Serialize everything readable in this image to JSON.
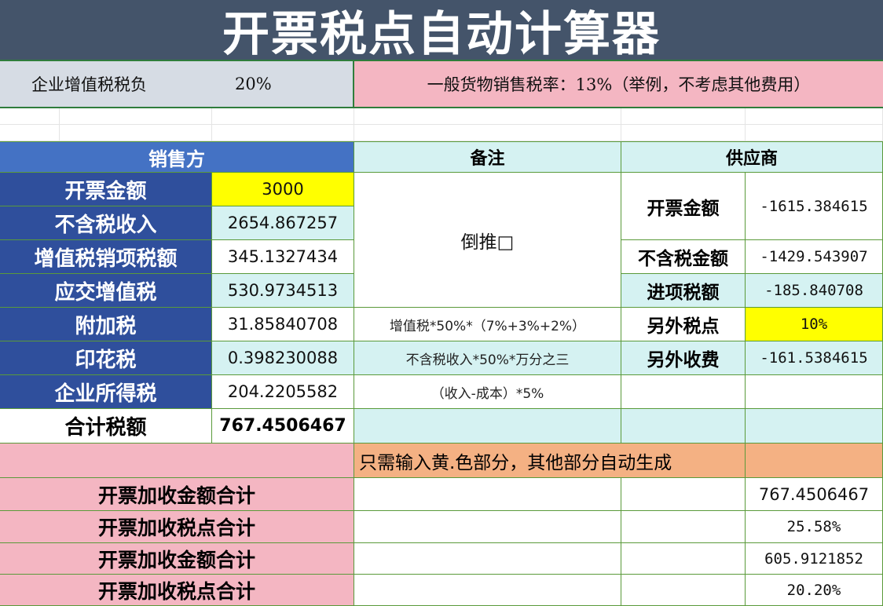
{
  "title": "开票税点自动计算器",
  "info": {
    "label": "企业增值税税负",
    "rate": "20%",
    "note": "一般货物销售税率：13%（举例，不考虑其他费用）"
  },
  "seller": {
    "header": "销售方",
    "rows": [
      {
        "label": "开票金额",
        "value": "3000"
      },
      {
        "label": "不含税收入",
        "value": "2654.867257"
      },
      {
        "label": "增值税销项税额",
        "value": "345.1327434"
      },
      {
        "label": "应交增值税",
        "value": "530.9734513"
      },
      {
        "label": "附加税",
        "value": "31.85840708"
      },
      {
        "label": "印花税",
        "value": "0.398230088"
      },
      {
        "label": "企业所得税",
        "value": "204.2205582"
      }
    ],
    "total_label": "合计税额",
    "total_value": "767.4506467"
  },
  "notes": {
    "header": "备注",
    "reverse": "倒推□",
    "surtax": "增值税*50%*（7%+3%+2%）",
    "stamp": "不含税收入*50%*万分之三",
    "income": "（收入-成本）*5%",
    "instruction": "只需输入黄.色部分，其他部分自动生成"
  },
  "supplier": {
    "header": "供应商",
    "invoice_label": "开票金额",
    "invoice_value": "-1615.384615",
    "net_label": "不含税金额",
    "net_value": "-1429.543907",
    "input_tax_label": "进项税额",
    "input_tax_value": "-185.840708",
    "extra_rate_label": "另外税点",
    "extra_rate_value": "10%",
    "extra_fee_label": "另外收费",
    "extra_fee_value": "-161.5384615"
  },
  "summary": [
    {
      "label": "开票加收金额合计",
      "value": "767.4506467"
    },
    {
      "label": "开票加收税点合计",
      "value": "25.58%"
    },
    {
      "label": "开票加收金额合计",
      "value": "605.9121852"
    },
    {
      "label": "开票加收税点合计",
      "value": "20.20%"
    }
  ],
  "colors": {
    "title_bg": "#44546a",
    "blue_header": "#4472c4",
    "blue_label": "#2f4f9c",
    "teal": "#d5f2f2",
    "yellow": "#ffff00",
    "pink": "#f4b6c2",
    "orange": "#f4b183",
    "border_green": "#5a9a3a"
  }
}
